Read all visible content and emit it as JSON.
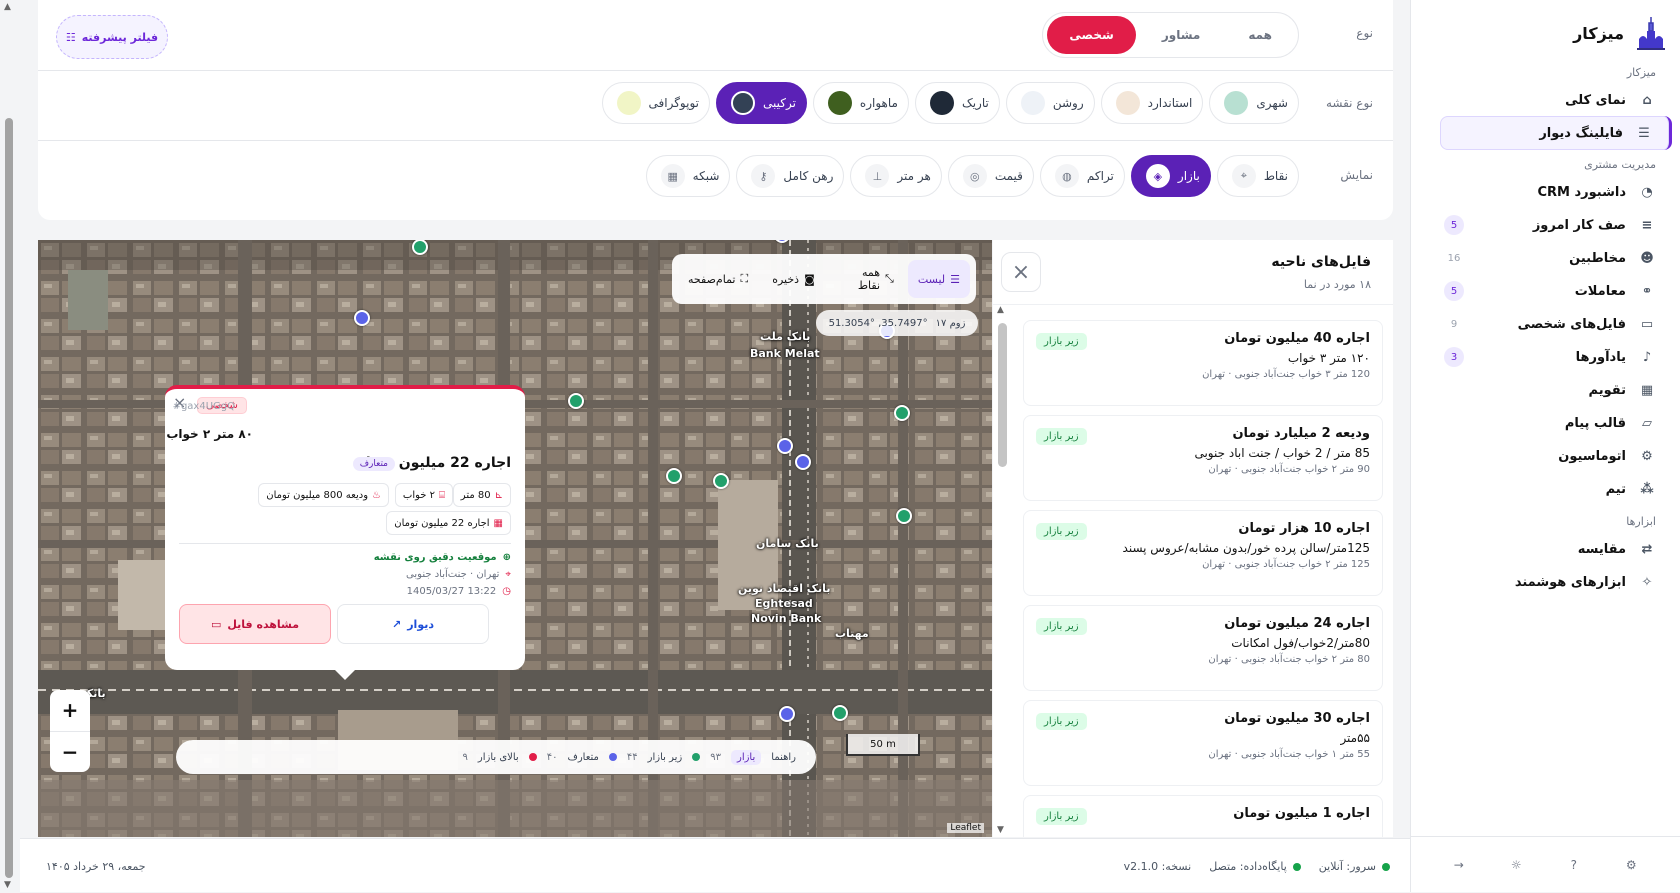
{
  "brand": {
    "name": "میزکار"
  },
  "sidebar": {
    "sections": [
      "میزکار",
      "مدیریت مشتری",
      "ابزارها"
    ],
    "items": [
      {
        "label": "نمای کلی",
        "badge": ""
      },
      {
        "label": "فایلینگ دیوار",
        "badge": ""
      },
      {
        "label": "داشبورد CRM",
        "badge": ""
      },
      {
        "label": "صف کار امروز",
        "badge": "5"
      },
      {
        "label": "مخاطبین",
        "badge": "16"
      },
      {
        "label": "معاملات",
        "badge": "5"
      },
      {
        "label": "فایل‌های شخصی",
        "badge": "9"
      },
      {
        "label": "یادآورها",
        "badge": "3"
      },
      {
        "label": "تقویم",
        "badge": ""
      },
      {
        "label": "قالب پیام",
        "badge": ""
      },
      {
        "label": "اتوماسیون",
        "badge": ""
      },
      {
        "label": "تیم",
        "badge": ""
      },
      {
        "label": "مقایسه",
        "badge": ""
      },
      {
        "label": "ابزارهای هوشمند",
        "badge": ""
      }
    ]
  },
  "filters": {
    "type_label": "نوع",
    "type_options": [
      "همه",
      "مشاور",
      "شخصی"
    ],
    "type_selected": "شخصی",
    "advanced_label": "فیلتر پیشرفته",
    "map_type_label": "نوع نقشه",
    "map_types": [
      {
        "label": "شهری",
        "color": "#b8e0d2"
      },
      {
        "label": "استاندارد",
        "color": "#f3e6d8"
      },
      {
        "label": "روشن",
        "color": "#eef2f7"
      },
      {
        "label": "تاریک",
        "color": "#1f2937"
      },
      {
        "label": "ماهواره",
        "color": "#3f5f1f"
      },
      {
        "label": "ترکیبی",
        "color": "#334155"
      },
      {
        "label": "توپوگرافی",
        "color": "#f1f5c6"
      }
    ],
    "map_type_selected": "ترکیبی",
    "display_label": "نمایش",
    "display_modes": [
      {
        "label": "نقاط",
        "icon": "pin-icon"
      },
      {
        "label": "بازار",
        "icon": "tag-icon"
      },
      {
        "label": "تراکم",
        "icon": "flame-icon"
      },
      {
        "label": "قیمت",
        "icon": "coins-icon"
      },
      {
        "label": "هر متر",
        "icon": "ruler-icon"
      },
      {
        "label": "رهن کامل",
        "icon": "key-icon"
      },
      {
        "label": "شبکه",
        "icon": "grid-icon"
      }
    ],
    "display_selected": "بازار"
  },
  "list_panel": {
    "title": "فایل‌های ناحیه",
    "subtitle": "۱۸ مورد در نما",
    "cards": [
      {
        "title": "اجاره 40 میلیون تومان",
        "desc": "۱۲۰ متر ۳ خواب",
        "meta": "120 متر   ۳ خواب   جنت‌آباد جنوبی · تهران",
        "tag": "زیر بازار"
      },
      {
        "title": "ودیعه 2 میلیارد تومان",
        "desc": "85 متر / 2 خواب / جنت اباد جنوبی",
        "meta": "90 متر   ۲ خواب   جنت‌آباد جنوبی · تهران",
        "tag": "زیر بازار"
      },
      {
        "title": "اجاره 10 هزار تومان",
        "desc": "125متر/سالن پرده خور/بدون مشابه/عروس پسند",
        "meta": "125 متر   ۲ خواب   جنت‌آباد جنوبی · تهران",
        "tag": "زیر بازار"
      },
      {
        "title": "اجاره 24 میلیون تومان",
        "desc": "80متر/2خواب/فول امکانات",
        "meta": "80 متر   ۲ خواب   جنت‌آباد جنوبی · تهران",
        "tag": "زیر بازار"
      },
      {
        "title": "اجاره 30 میلیون تومان",
        "desc": "۵۵متر",
        "meta": "55 متر   ۱ خواب   جنت‌آباد جنوبی · تهران",
        "tag": "زیر بازار"
      },
      {
        "title": "اجاره 1 میلیون تومان",
        "desc": "",
        "meta": "",
        "tag": "زیر بازار"
      }
    ]
  },
  "map": {
    "toolbar": [
      "لیست",
      "همه نقاط",
      "ذخیره",
      "تمام‌صفحه"
    ],
    "zoom_label": "زوم ۱۷",
    "coords": "51.3054° ,35.7497°",
    "labels": [
      "بانک ملت",
      "Bank Melat",
      "بانک سامان",
      "بانک اقتصاد نوین",
      "Eghtesad",
      "Novin Bank",
      "مهتاب",
      "بانک"
    ],
    "popup": {
      "code": "#gax4UGgQ",
      "type": "شخصی",
      "area": "۸۰ متر ۲ خواب",
      "price": "اجاره 22 میلیون تومان",
      "status": "متعارف",
      "chips": [
        "80 متر",
        "۲ خواب",
        "ودیعه 800 میلیون تومان",
        "اجاره 22 میلیون تومان"
      ],
      "exact_location": "موقعیت دقیق روی نقشه",
      "address": "تهران · جنت‌آباد جنوبی",
      "datetime": "13:22 1405/03/27",
      "divar_button": "دیوار",
      "view_button": "مشاهده فایل"
    },
    "legend": {
      "title": "راهنما",
      "active": "بازار",
      "items": [
        {
          "label": "زیر بازار",
          "count": "۴۴",
          "color": "#22a06b",
          "prefix_count": "۹۳"
        },
        {
          "label": "متعارف",
          "count": "۴۰",
          "color": "#5b63e8"
        },
        {
          "label": "بالای بازار",
          "count": "۹",
          "color": "#e11d48"
        }
      ]
    },
    "scale": "50 m",
    "attribution": "Leaflet"
  },
  "status_bar": {
    "server": "سرور: آنلاین",
    "database": "پایگاه‌داده: متصل",
    "version": "نسخه: v2.1.0",
    "date": "جمعه، ۲۹ خرداد ۱۴۰۵"
  }
}
